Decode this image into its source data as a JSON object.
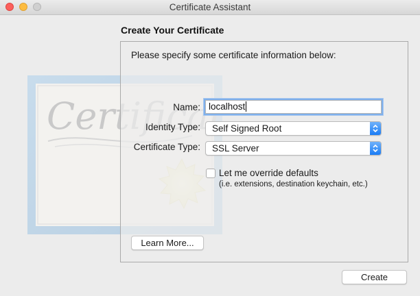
{
  "window": {
    "title": "Certificate Assistant",
    "traffic_lights": [
      {
        "name": "close",
        "color": "#fc605c"
      },
      {
        "name": "minimize",
        "color": "#fdbc40"
      },
      {
        "name": "zoom",
        "color": "#d0d0d0"
      }
    ]
  },
  "page": {
    "heading": "Create Your Certificate",
    "intro": "Please specify some certificate information below:"
  },
  "illustration": {
    "text": "Certificate",
    "icon": "certificate-illustration"
  },
  "form": {
    "name_label": "Name:",
    "name_value": "localhost",
    "identity_type_label": "Identity Type:",
    "identity_type_value": "Self Signed Root",
    "certificate_type_label": "Certificate Type:",
    "certificate_type_value": "SSL Server",
    "override_label": "Let me override defaults",
    "override_checked": false,
    "override_sub": "(i.e. extensions, destination keychain, etc.)"
  },
  "buttons": {
    "learn_more": "Learn More...",
    "create": "Create"
  },
  "colors": {
    "accent": "#1a7cf5",
    "focus_ring": "#7fb0ec"
  }
}
